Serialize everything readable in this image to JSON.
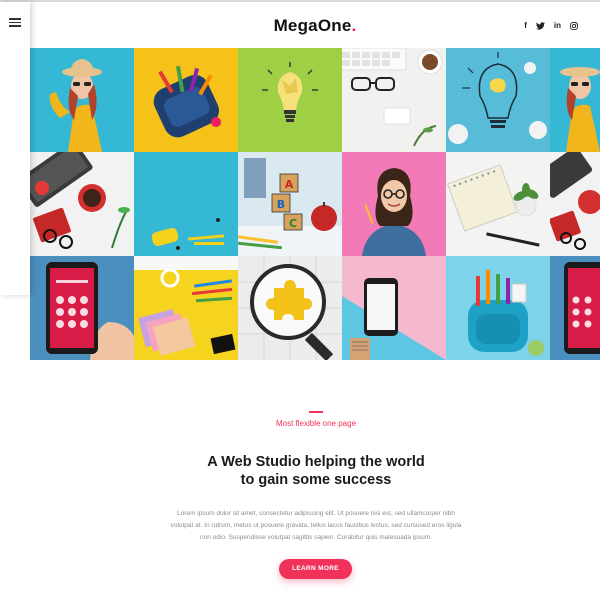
{
  "brand": {
    "name_main": "MegaOne",
    "name_dot": "."
  },
  "social": [
    {
      "label": "f",
      "icon": "facebook-icon"
    },
    {
      "label": "t",
      "icon": "twitter-icon"
    },
    {
      "label": "in",
      "icon": "linkedin-icon"
    },
    {
      "label": "◎",
      "icon": "instagram-icon"
    }
  ],
  "menu": {
    "icon": "hamburger-icon"
  },
  "gallery": {
    "tiles": [
      {
        "name": "woman-in-yellow-hat",
        "bg": "#35b8d4"
      },
      {
        "name": "backpack-supplies",
        "bg": "#f6c21a"
      },
      {
        "name": "crumpled-lightbulb",
        "bg": "#9fcf45"
      },
      {
        "name": "keyboard-glasses-coffee",
        "bg": "#f1f1ef"
      },
      {
        "name": "lightbulb-drawing",
        "bg": "#56bcd8"
      },
      {
        "name": "woman-in-yellow-hat-edge",
        "bg": "#35b8d4"
      },
      {
        "name": "laptop-coffee",
        "bg": "#f2f2f2"
      },
      {
        "name": "blue-stationery",
        "bg": "#35b8d4"
      },
      {
        "name": "abc-blocks-apple",
        "bg": "#d9e9ef"
      },
      {
        "name": "woman-with-glasses",
        "bg": "#f27ab6"
      },
      {
        "name": "notebook-plant",
        "bg": "#f3f3f1"
      },
      {
        "name": "laptop-coffee-edge",
        "bg": "#f2f2f2"
      },
      {
        "name": "phone-in-hand",
        "bg": "#4b8fbf"
      },
      {
        "name": "yellow-stationery",
        "bg": "#f6d31f"
      },
      {
        "name": "puzzle-magnifier",
        "bg": "#e9e9e9"
      },
      {
        "name": "phone-on-pastel",
        "bg": "#f5b9cf"
      },
      {
        "name": "blue-backpack",
        "bg": "#7dd3e8"
      },
      {
        "name": "phone-in-hand-edge",
        "bg": "#4b8fbf"
      }
    ]
  },
  "intro": {
    "eyebrow": "Most flexible one page",
    "headline_line1": "A Web Studio helping the world",
    "headline_line2": "to gain some success",
    "body_line1": "Lorem ipsum dolor sit amet, consectetur adipiscing elit. Ut posuere nisi est, sed ullamcorper nibh",
    "body_line2": "volutpat at. In rutrum, metus ut posuere gravida, tellus lacus faucibus lectus, sed cursused eros ligula",
    "body_line3": "non odio. Suspendisse volutpat sagittis sapien. Curabitur quis malesuada ipsum.",
    "cta": "LEARN MORE"
  },
  "colors": {
    "accent": "#f0325b",
    "text": "#1a1a1a",
    "muted": "#8d8d8d"
  }
}
